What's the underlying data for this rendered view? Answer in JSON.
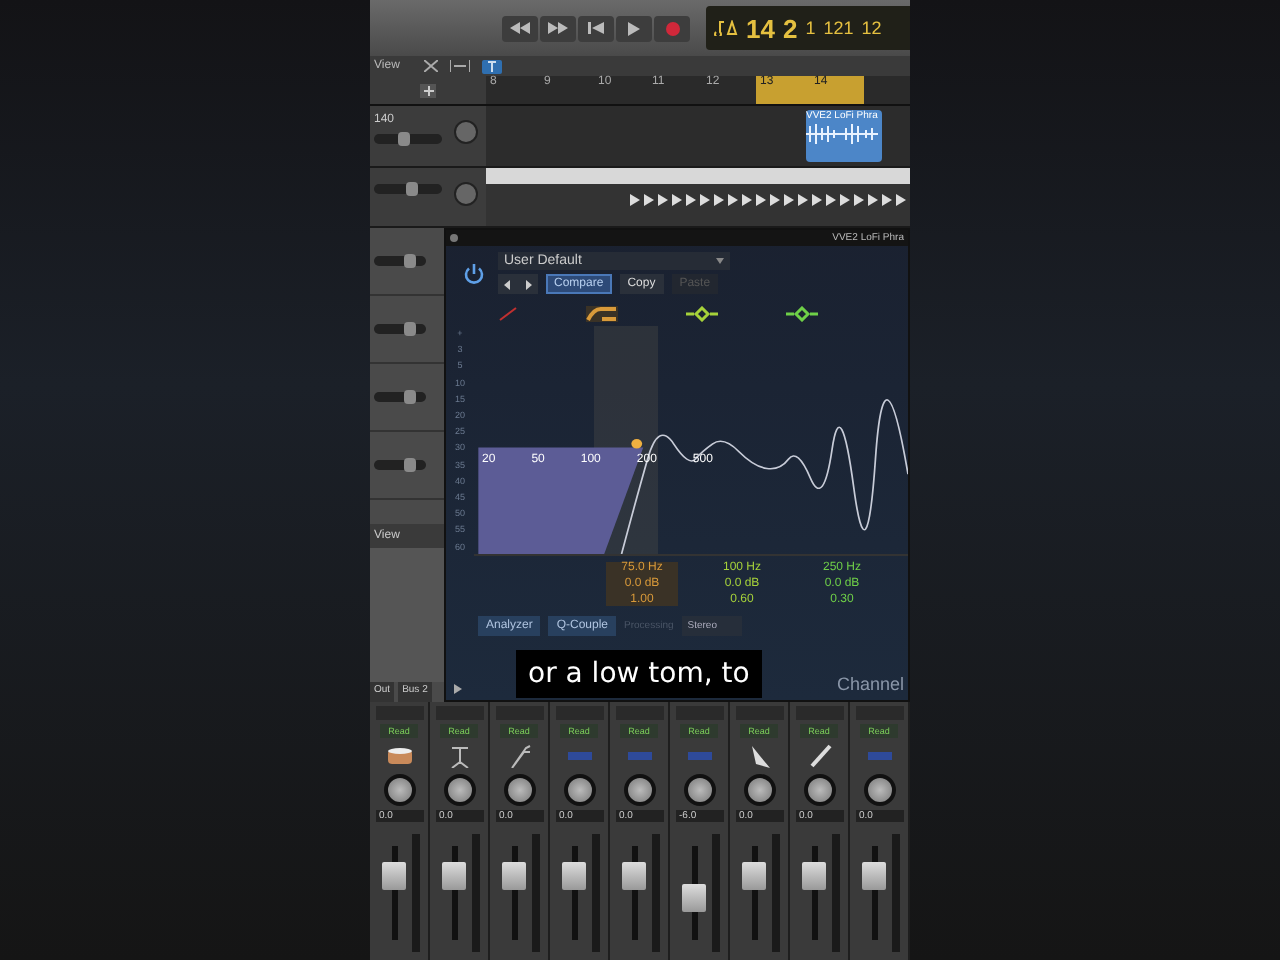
{
  "transport": {
    "lcd": {
      "bar": "14",
      "beat": "2",
      "division": "1",
      "tick": "121",
      "tempo": "12"
    }
  },
  "toolbar": {
    "view_menu": "View"
  },
  "ruler": {
    "marks": [
      "8",
      "9",
      "10",
      "11",
      "12",
      "13",
      "14"
    ]
  },
  "tracks": [
    {
      "name": "140",
      "level": 0.45
    },
    {
      "level": 0.55
    }
  ],
  "region": {
    "name": "VVE2 LoFi Phra"
  },
  "side_panel": {
    "view_menu": "View",
    "sends": [
      "Out",
      "Bus 2"
    ],
    "faders": [
      {
        "level": 0.7
      },
      {
        "level": 0.7
      },
      {
        "level": 0.7
      },
      {
        "level": 0.7
      }
    ]
  },
  "plugin": {
    "title": "VVE2 LoFi Phra",
    "preset": "User Default",
    "buttons": [
      {
        "label": "Compare",
        "selected": true,
        "disabled": false
      },
      {
        "label": "Copy",
        "selected": false,
        "disabled": false
      },
      {
        "label": "Paste",
        "selected": false,
        "disabled": true
      }
    ],
    "db_scale": [
      "+",
      "3",
      "5",
      "10",
      "15",
      "20",
      "25",
      "30",
      "35",
      "40",
      "45",
      "50",
      "55",
      "60"
    ],
    "freq_labels": [
      "20",
      "50",
      "100",
      "200",
      "500"
    ],
    "bands": [
      {
        "kind": "highpass",
        "color": "#d99a3a",
        "selected": true,
        "freq": "75.0 Hz",
        "gain": "0.0 dB",
        "q": "1.00"
      },
      {
        "kind": "bell",
        "color": "#a6d23a",
        "selected": false,
        "freq": "100 Hz",
        "gain": "0.0 dB",
        "q": "0.60"
      },
      {
        "kind": "bell",
        "color": "#6fd048",
        "selected": false,
        "freq": "250 Hz",
        "gain": "0.0 dB",
        "q": "0.30"
      }
    ],
    "analyzer": "Analyzer",
    "q_couple": "Q-Couple",
    "processing": "Processing",
    "processing_mode": "Stereo",
    "footer": "Channel"
  },
  "mixer": [
    {
      "kind": "drum",
      "automation": "Read",
      "value": "0.0",
      "level": 0.68
    },
    {
      "kind": "stand",
      "automation": "Read",
      "value": "0.0",
      "level": 0.68
    },
    {
      "kind": "tongs",
      "automation": "Read",
      "value": "0.0",
      "level": 0.68
    },
    {
      "kind": "slot",
      "automation": "Read",
      "value": "0.0",
      "level": 0.68
    },
    {
      "kind": "slot",
      "automation": "Read",
      "value": "0.0",
      "level": 0.68
    },
    {
      "kind": "slot",
      "automation": "Read",
      "value": "-6.0",
      "level": 0.45
    },
    {
      "kind": "horn",
      "automation": "Read",
      "value": "0.0",
      "level": 0.68
    },
    {
      "kind": "stick",
      "automation": "Read",
      "value": "0.0",
      "level": 0.68
    },
    {
      "kind": "slot",
      "automation": "Read",
      "value": "0.0",
      "level": 0.68
    }
  ],
  "subtitle": "or a low tom, to"
}
